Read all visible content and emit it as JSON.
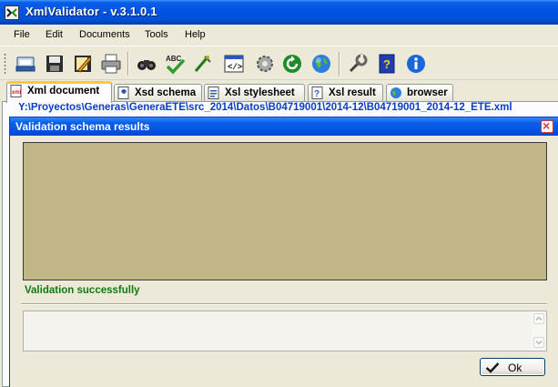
{
  "window": {
    "title": "XmlValidator - v.3.1.0.1"
  },
  "menu": {
    "items": [
      "File",
      "Edit",
      "Documents",
      "Tools",
      "Help"
    ]
  },
  "toolbar": {
    "buttons": [
      "open-icon",
      "save-icon",
      "edit-icon",
      "print-icon",
      "find-icon",
      "spellcheck-icon",
      "format-icon",
      "code-view-icon",
      "settings-icon",
      "refresh-icon",
      "globe-icon",
      "tools-icon",
      "help-book-icon",
      "info-icon"
    ]
  },
  "tabs": [
    {
      "label": "Xml document",
      "icon": "xml-document-icon",
      "active": true
    },
    {
      "label": "Xsd schema",
      "icon": "xsd-schema-icon",
      "active": false
    },
    {
      "label": "Xsl stylesheet",
      "icon": "xsl-stylesheet-icon",
      "active": false
    },
    {
      "label": "Xsl result",
      "icon": "xsl-result-icon",
      "active": false
    },
    {
      "label": "browser",
      "icon": "browser-icon",
      "active": false
    }
  ],
  "document": {
    "path": "Y:\\Proyectos\\Generas\\GeneraETE\\src_2014\\Datos\\B04719001\\2014-12\\B04719001_2014-12_ETE.xml"
  },
  "dialog": {
    "title": "Validation schema results",
    "status": "Validation successfully",
    "ok_label": "Ok",
    "colors": {
      "result_box": "#c1b687",
      "status": "#0d7b0d",
      "title_bar": "#0054e3"
    }
  }
}
